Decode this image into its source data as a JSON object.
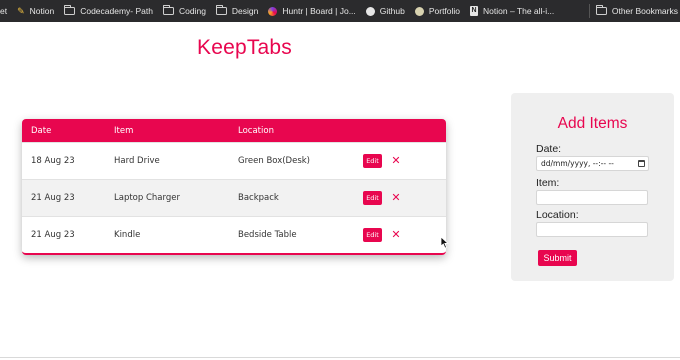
{
  "bookmarks": {
    "items": [
      {
        "label": "et",
        "icon": "none"
      },
      {
        "label": "Notion",
        "icon": "notion-pencil-icon"
      },
      {
        "label": "Codecademy- Path",
        "icon": "folder-icon"
      },
      {
        "label": "Coding",
        "icon": "folder-icon"
      },
      {
        "label": "Design",
        "icon": "folder-icon"
      },
      {
        "label": "Huntr | Board | Jo...",
        "icon": "huntr-icon"
      },
      {
        "label": "Github",
        "icon": "github-icon"
      },
      {
        "label": "Portfolio",
        "icon": "portfolio-icon"
      },
      {
        "label": "Notion – The all-i...",
        "icon": "notion-doc-icon"
      }
    ],
    "other": "Other Bookmarks"
  },
  "brand": "KeepTabs",
  "table": {
    "headers": {
      "date": "Date",
      "item": "Item",
      "location": "Location"
    },
    "rows": [
      {
        "date": "18 Aug 23",
        "item": "Hard Drive",
        "location": "Green Box(Desk)"
      },
      {
        "date": "21 Aug 23",
        "item": "Laptop Charger",
        "location": "Backpack"
      },
      {
        "date": "21 Aug 23",
        "item": "Kindle",
        "location": "Bedside Table"
      }
    ],
    "edit_label": "Edit",
    "delete_glyph": "✕"
  },
  "form": {
    "title": "Add Items",
    "date_label": "Date:",
    "date_value": "dd/mm/yyyy, --:-- --",
    "item_label": "Item:",
    "item_value": "",
    "location_label": "Location:",
    "location_value": "",
    "submit_label": "Submit"
  },
  "colors": {
    "accent": "#e8064f",
    "panel": "#efefef",
    "bookmarks_bar": "#2b2b2d"
  }
}
